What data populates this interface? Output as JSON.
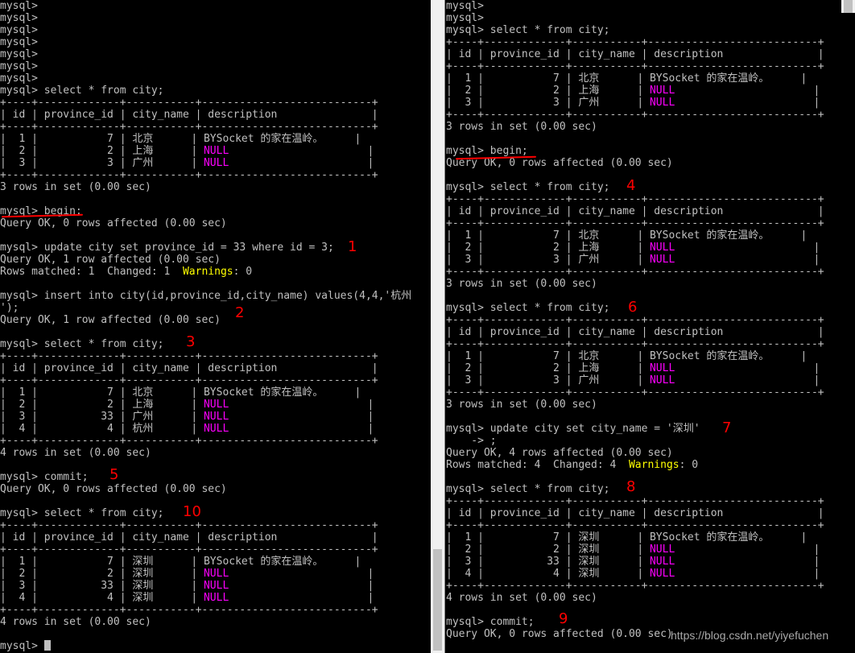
{
  "left": {
    "lines": [
      {
        "t": "mysql>"
      },
      {
        "t": "mysql>"
      },
      {
        "t": "mysql>"
      },
      {
        "t": "mysql>"
      },
      {
        "t": "mysql>"
      },
      {
        "t": "mysql>"
      },
      {
        "t": "mysql>"
      },
      {
        "t": "mysql> select * from city;"
      },
      {
        "t": "+----+-------------+-----------+---------------------------+"
      },
      {
        "t": "| id | province_id | city_name | description               |"
      },
      {
        "t": "+----+-------------+-----------+---------------------------+"
      },
      {
        "t": "|  1 |           7 | 北京      | BYSocket 的家在温岭。     |"
      },
      {
        "p": "|  2 |           2 | 上海      | ",
        "n": "NULL",
        "s": "                      |"
      },
      {
        "p": "|  3 |           3 | 广州      | ",
        "n": "NULL",
        "s": "                      |"
      },
      {
        "t": "+----+-------------+-----------+---------------------------+"
      },
      {
        "t": "3 rows in set (0.00 sec)"
      },
      {
        "t": ""
      },
      {
        "t": "mysql> begin;"
      },
      {
        "t": "Query OK, 0 rows affected (0.00 sec)"
      },
      {
        "t": ""
      },
      {
        "t": "mysql> update city set province_id = 33 where id = 3;"
      },
      {
        "t": "Query OK, 1 row affected (0.00 sec)"
      },
      {
        "p": "Rows matched: 1  Changed: 1  ",
        "w": "Warnings",
        "s": ": 0"
      },
      {
        "t": ""
      },
      {
        "t": "mysql> insert into city(id,province_id,city_name) values(4,4,'杭州"
      },
      {
        "t": "');"
      },
      {
        "t": "Query OK, 1 row affected (0.00 sec)"
      },
      {
        "t": ""
      },
      {
        "t": "mysql> select * from city;"
      },
      {
        "t": "+----+-------------+-----------+---------------------------+"
      },
      {
        "t": "| id | province_id | city_name | description               |"
      },
      {
        "t": "+----+-------------+-----------+---------------------------+"
      },
      {
        "t": "|  1 |           7 | 北京      | BYSocket 的家在温岭。     |"
      },
      {
        "p": "|  2 |           2 | 上海      | ",
        "n": "NULL",
        "s": "                      |"
      },
      {
        "p": "|  3 |          33 | 广州      | ",
        "n": "NULL",
        "s": "                      |"
      },
      {
        "p": "|  4 |           4 | 杭州      | ",
        "n": "NULL",
        "s": "                      |"
      },
      {
        "t": "+----+-------------+-----------+---------------------------+"
      },
      {
        "t": "4 rows in set (0.00 sec)"
      },
      {
        "t": ""
      },
      {
        "t": "mysql> commit;"
      },
      {
        "t": "Query OK, 0 rows affected (0.00 sec)"
      },
      {
        "t": ""
      },
      {
        "t": "mysql> select * from city;"
      },
      {
        "t": "+----+-------------+-----------+---------------------------+"
      },
      {
        "t": "| id | province_id | city_name | description               |"
      },
      {
        "t": "+----+-------------+-----------+---------------------------+"
      },
      {
        "t": "|  1 |           7 | 深圳      | BYSocket 的家在温岭。     |"
      },
      {
        "p": "|  2 |           2 | 深圳      | ",
        "n": "NULL",
        "s": "                      |"
      },
      {
        "p": "|  3 |          33 | 深圳      | ",
        "n": "NULL",
        "s": "                      |"
      },
      {
        "p": "|  4 |           4 | 深圳      | ",
        "n": "NULL",
        "s": "                      |"
      },
      {
        "t": "+----+-------------+-----------+---------------------------+"
      },
      {
        "t": "4 rows in set (0.00 sec)"
      },
      {
        "t": ""
      },
      {
        "t": "mysql> ",
        "cursor": true
      }
    ]
  },
  "right": {
    "lines": [
      {
        "t": "mysql>"
      },
      {
        "t": "mysql>"
      },
      {
        "t": "mysql> select * from city;"
      },
      {
        "t": "+----+-------------+-----------+---------------------------+"
      },
      {
        "t": "| id | province_id | city_name | description               |"
      },
      {
        "t": "+----+-------------+-----------+---------------------------+"
      },
      {
        "t": "|  1 |           7 | 北京      | BYSocket 的家在温岭。     |"
      },
      {
        "p": "|  2 |           2 | 上海      | ",
        "n": "NULL",
        "s": "                      |"
      },
      {
        "p": "|  3 |           3 | 广州      | ",
        "n": "NULL",
        "s": "                      |"
      },
      {
        "t": "+----+-------------+-----------+---------------------------+"
      },
      {
        "t": "3 rows in set (0.00 sec)"
      },
      {
        "t": ""
      },
      {
        "t": "mysql> begin;"
      },
      {
        "t": "Query OK, 0 rows affected (0.00 sec)"
      },
      {
        "t": ""
      },
      {
        "t": "mysql> select * from city;"
      },
      {
        "t": "+----+-------------+-----------+---------------------------+"
      },
      {
        "t": "| id | province_id | city_name | description               |"
      },
      {
        "t": "+----+-------------+-----------+---------------------------+"
      },
      {
        "t": "|  1 |           7 | 北京      | BYSocket 的家在温岭。     |"
      },
      {
        "p": "|  2 |           2 | 上海      | ",
        "n": "NULL",
        "s": "                      |"
      },
      {
        "p": "|  3 |           3 | 广州      | ",
        "n": "NULL",
        "s": "                      |"
      },
      {
        "t": "+----+-------------+-----------+---------------------------+"
      },
      {
        "t": "3 rows in set (0.00 sec)"
      },
      {
        "t": ""
      },
      {
        "t": "mysql> select * from city;"
      },
      {
        "t": "+----+-------------+-----------+---------------------------+"
      },
      {
        "t": "| id | province_id | city_name | description               |"
      },
      {
        "t": "+----+-------------+-----------+---------------------------+"
      },
      {
        "t": "|  1 |           7 | 北京      | BYSocket 的家在温岭。     |"
      },
      {
        "p": "|  2 |           2 | 上海      | ",
        "n": "NULL",
        "s": "                      |"
      },
      {
        "p": "|  3 |           3 | 广州      | ",
        "n": "NULL",
        "s": "                      |"
      },
      {
        "t": "+----+-------------+-----------+---------------------------+"
      },
      {
        "t": "3 rows in set (0.00 sec)"
      },
      {
        "t": ""
      },
      {
        "t": "mysql> update city set city_name = '深圳'"
      },
      {
        "t": "    -> ;"
      },
      {
        "t": "Query OK, 4 rows affected (0.00 sec)"
      },
      {
        "p": "Rows matched: 4  Changed: 4  ",
        "w": "Warnings",
        "s": ": 0"
      },
      {
        "t": ""
      },
      {
        "t": "mysql> select * from city;"
      },
      {
        "t": "+----+-------------+-----------+---------------------------+"
      },
      {
        "t": "| id | province_id | city_name | description               |"
      },
      {
        "t": "+----+-------------+-----------+---------------------------+"
      },
      {
        "t": "|  1 |           7 | 深圳      | BYSocket 的家在温岭。     |"
      },
      {
        "p": "|  2 |           2 | 深圳      | ",
        "n": "NULL",
        "s": "                      |"
      },
      {
        "p": "|  3 |          33 | 深圳      | ",
        "n": "NULL",
        "s": "                      |"
      },
      {
        "p": "|  4 |           4 | 深圳      | ",
        "n": "NULL",
        "s": "                      |"
      },
      {
        "t": "+----+-------------+-----------+---------------------------+"
      },
      {
        "t": "4 rows in set (0.00 sec)"
      },
      {
        "t": ""
      },
      {
        "t": "mysql> commit;"
      },
      {
        "t": "Query OK, 0 rows affected (0.00 sec)"
      },
      {
        "t": ""
      }
    ]
  },
  "annotations": {
    "a1": "1",
    "a2": "2",
    "a3": "3",
    "a4": "4",
    "a5": "5",
    "a6": "6",
    "a7": "7",
    "a8": "8",
    "a9": "9",
    "a10": "10"
  },
  "watermark": "https://blog.csdn.net/yiyefuchen",
  "colors": {
    "background": "#000000",
    "text": "#c0c0c0",
    "null": "#ff00ff",
    "warnings": "#ffff00",
    "annotation": "#ff0000"
  }
}
